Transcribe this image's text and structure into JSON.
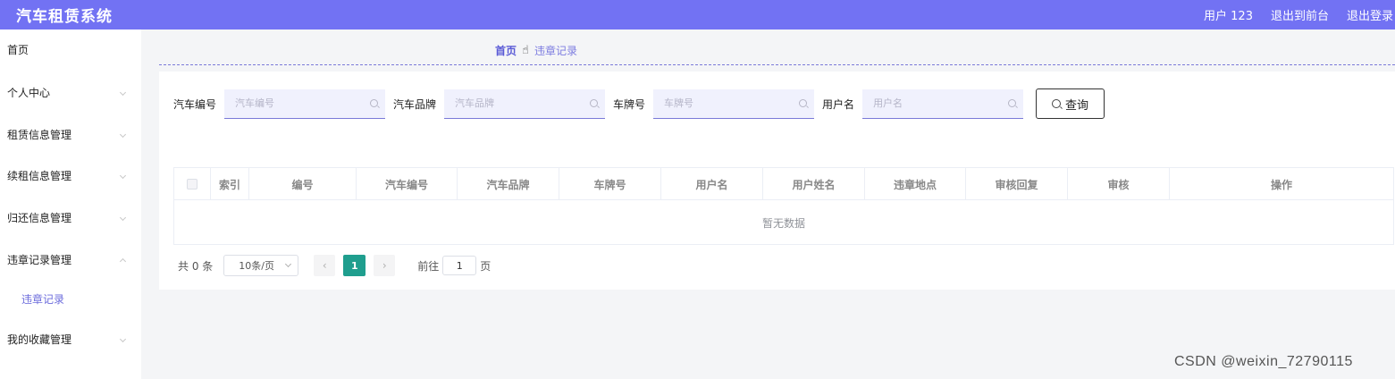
{
  "header": {
    "title": "汽车租赁系统",
    "user": "用户 123",
    "front_link": "退出到前台",
    "logout_link": "退出登录",
    "bg_color": "#7272f3"
  },
  "sidebar": {
    "items": [
      {
        "label": "首页"
      },
      {
        "label": "个人中心"
      },
      {
        "label": "租赁信息管理"
      },
      {
        "label": "续租信息管理"
      },
      {
        "label": "归还信息管理"
      },
      {
        "label": "违章记录管理"
      },
      {
        "label": "我的收藏管理"
      }
    ],
    "sub_item": "违章记录"
  },
  "breadcrumb": {
    "home": "首页",
    "separator_icon": "hand-pointer-icon",
    "current": "违章记录"
  },
  "search": {
    "fields": [
      {
        "label": "汽车编号",
        "placeholder": "汽车编号"
      },
      {
        "label": "汽车品牌",
        "placeholder": "汽车品牌"
      },
      {
        "label": "车牌号",
        "placeholder": "车牌号"
      },
      {
        "label": "用户名",
        "placeholder": "用户名"
      }
    ],
    "button": "查询"
  },
  "table": {
    "columns": [
      "索引",
      "编号",
      "汽车编号",
      "汽车品牌",
      "车牌号",
      "用户名",
      "用户姓名",
      "违章地点",
      "审核回复",
      "审核",
      "操作"
    ],
    "empty_text": "暂无数据"
  },
  "pagination": {
    "total": "共 0 条",
    "page_size": "10条/页",
    "current_page": "1",
    "goto_label": "前往",
    "goto_value": "1",
    "page_suffix": "页",
    "active_color": "#1f9e8e"
  },
  "watermark": "CSDN @weixin_72790115"
}
